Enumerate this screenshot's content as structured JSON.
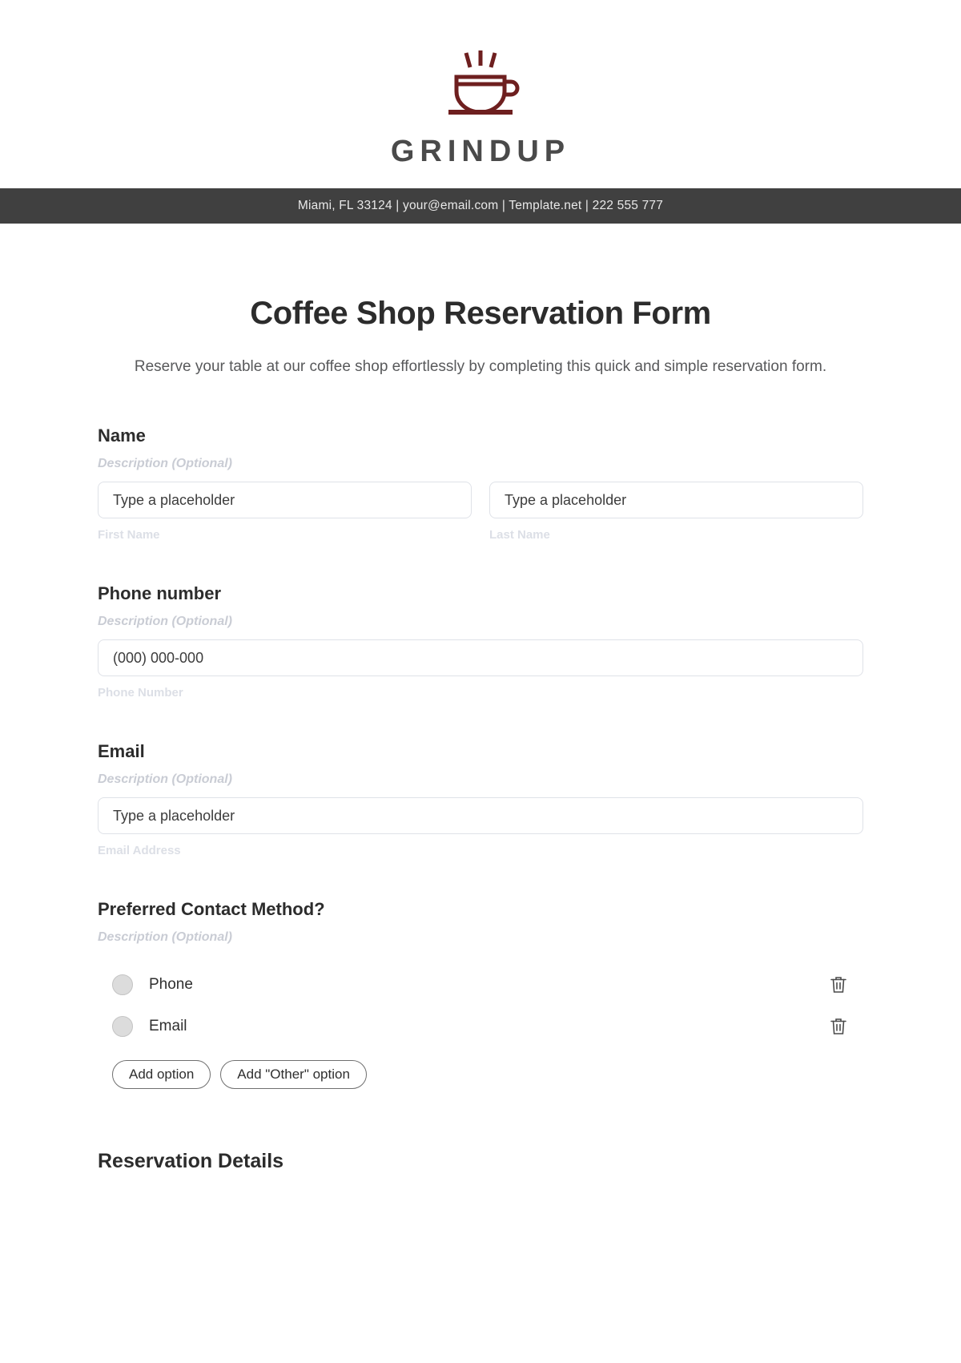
{
  "brand": {
    "name": "GRINDUP",
    "logo_icon": "coffee-cup-icon",
    "logo_color": "#6E1F1F"
  },
  "contact_bar": {
    "text": "Miami, FL 33124 | your@email.com | Template.net | 222 555 777",
    "background": "#404040",
    "text_color": "#E9E9E9"
  },
  "form": {
    "title": "Coffee Shop Reservation Form",
    "subtitle": "Reserve your table at our coffee shop effortlessly by completing this quick and simple reservation form.",
    "fields": {
      "name": {
        "label": "Name",
        "description": "Description (Optional)",
        "first": {
          "placeholder": "Type a placeholder",
          "sub_label": "First Name",
          "value": ""
        },
        "last": {
          "placeholder": "Type a placeholder",
          "sub_label": "Last Name",
          "value": ""
        }
      },
      "phone": {
        "label": "Phone number",
        "description": "Description (Optional)",
        "placeholder": "(000) 000-000",
        "sub_label": "Phone Number",
        "value": ""
      },
      "email": {
        "label": "Email",
        "description": "Description (Optional)",
        "placeholder": "Type a placeholder",
        "sub_label": "Email Address",
        "value": ""
      },
      "contact_method": {
        "label": "Preferred Contact Method?",
        "description": "Description (Optional)",
        "options": [
          {
            "label": "Phone",
            "selected": false,
            "delete_icon": "trash-icon"
          },
          {
            "label": "Email",
            "selected": false,
            "delete_icon": "trash-icon"
          }
        ],
        "add_option_label": "Add option",
        "add_other_option_label": "Add \"Other\" option"
      }
    },
    "sections": {
      "reservation_details": "Reservation Details"
    }
  }
}
